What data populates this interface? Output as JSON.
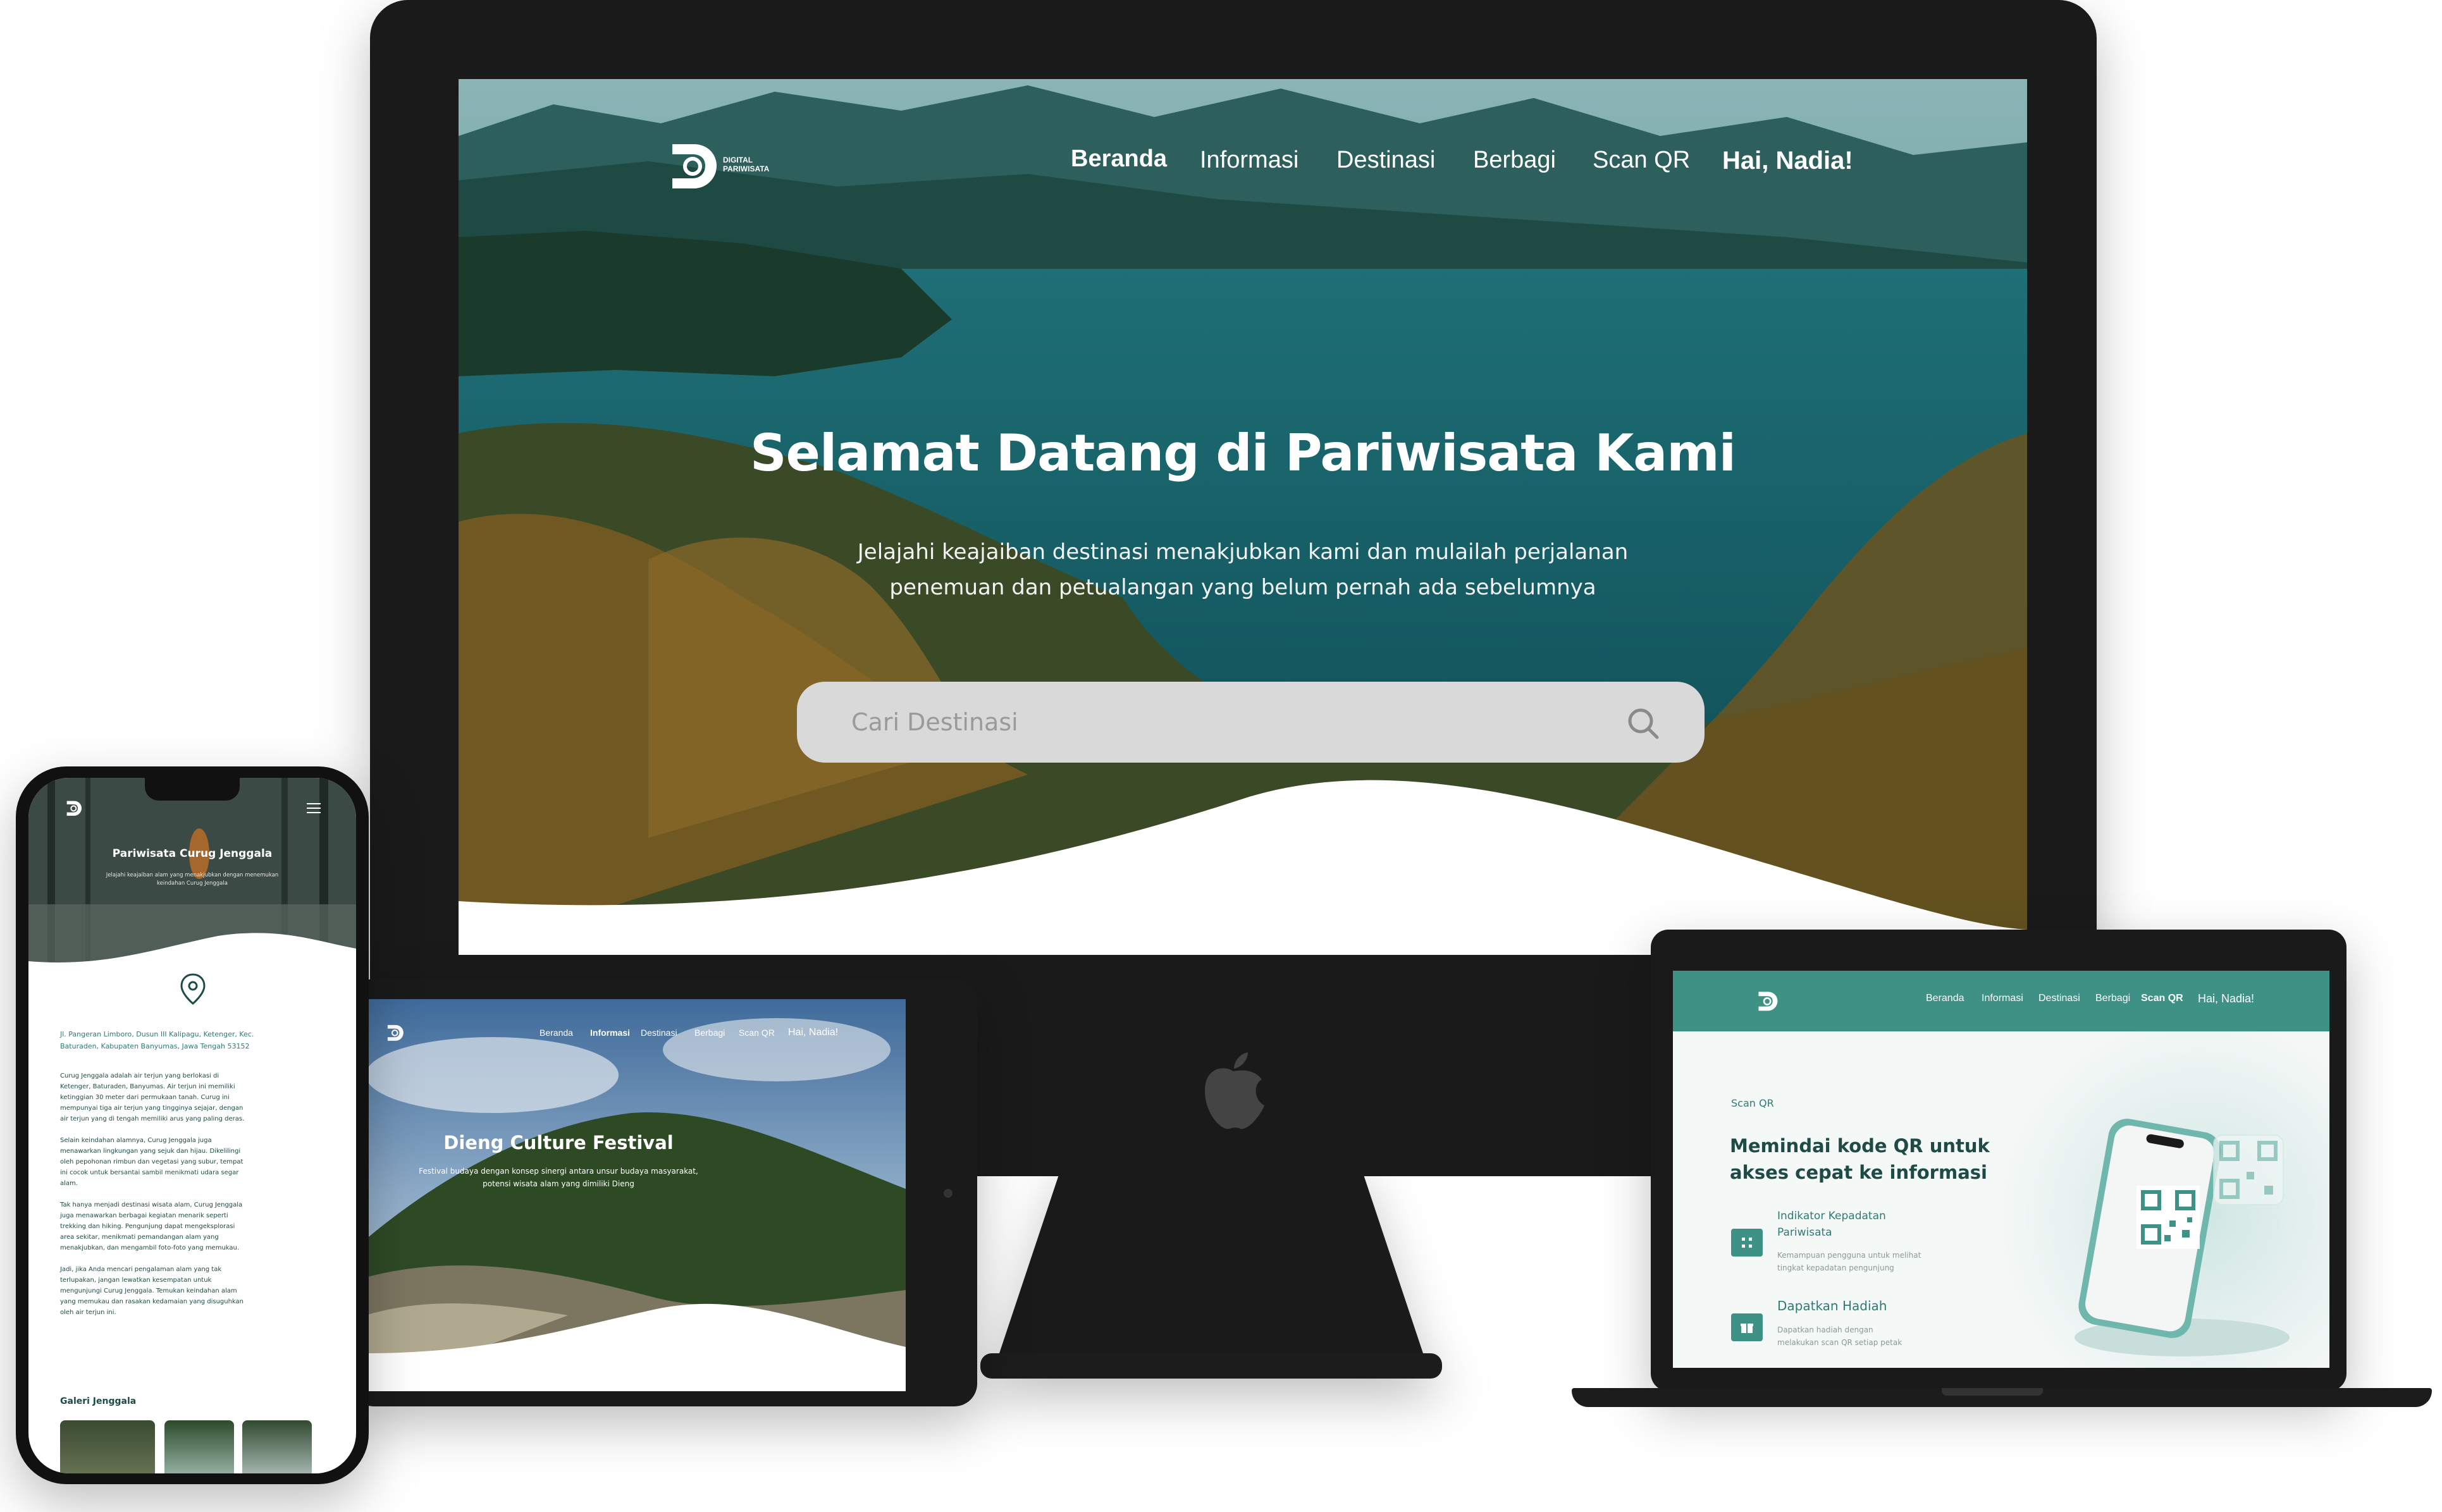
{
  "monitor": {
    "logo_line1": "DIGITAL",
    "logo_line2": "PARIWISATA",
    "nav": [
      "Beranda",
      "Informasi",
      "Destinasi",
      "Berbagi",
      "Scan QR",
      "Hai, Nadia!"
    ],
    "hero_title": "Selamat Datang di Pariwisata Kami",
    "hero_subtitle_line1": "Jelajahi keajaiban destinasi menakjubkan kami dan mulailah perjalanan",
    "hero_subtitle_line2": "penemuan dan petualangan yang belum pernah ada sebelumnya",
    "search_placeholder": "Cari Destinasi"
  },
  "tablet": {
    "nav": [
      "Beranda",
      "Informasi",
      "Destinasi",
      "Berbagi",
      "Scan QR",
      "Hai, Nadia!"
    ],
    "hero_title": "Dieng Culture Festival",
    "hero_subtitle_line1": "Festival budaya dengan konsep sinergi antara unsur budaya masyarakat,",
    "hero_subtitle_line2": "potensi wisata alam yang dimiliki Dieng"
  },
  "laptop": {
    "nav": [
      "Beranda",
      "Informasi",
      "Destinasi",
      "Berbagi",
      "Scan QR",
      "Hai, Nadia!"
    ],
    "section_label": "Scan QR",
    "heading_line1": "Memindai kode QR untuk",
    "heading_line2": "akses cepat ke informasi",
    "feature1_title_line1": "Indikator Kepadatan",
    "feature1_title_line2": "Pariwisata",
    "feature1_desc_line1": "Kemampuan pengguna untuk melihat",
    "feature1_desc_line2": "tingkat kepadatan pengunjung",
    "feature2_title": "Dapatkan Hadiah",
    "feature2_desc_line1": "Dapatkan hadiah dengan",
    "feature2_desc_line2": "melakukan scan QR setiap petak"
  },
  "phone": {
    "hero_title": "Pariwisata Curug Jenggala",
    "hero_subtitle_line1": "Jelajahi keajaiban alam yang menakjubkan dengan menemukan",
    "hero_subtitle_line2": "keindahan Curug Jenggala",
    "address_line1": "Jl. Pangeran Limboro, Dusun III Kalipagu, Ketenger, Kec.",
    "address_line2": "Baturaden, Kabupaten Banyumas, Jawa Tengah 53152",
    "p1": [
      "Curug Jenggala adalah air terjun yang berlokasi di",
      "Ketenger, Baturaden, Banyumas. Air terjun ini memiliki",
      "ketinggian 30 meter dari permukaan tanah. Curug ini",
      "mempunyai tiga air terjun yang tingginya sejajar, dengan",
      "air terjun yang di tengah memiliki arus yang paling deras."
    ],
    "p2": [
      "Selain keindahan alamnya, Curug Jenggala juga",
      "menawarkan lingkungan yang sejuk dan hijau. Dikelilingi",
      "oleh pepohonan rimbun dan vegetasi yang subur, tempat",
      "ini cocok untuk bersantai sambil menikmati udara segar",
      "alam."
    ],
    "p3": [
      "Tak hanya menjadi destinasi wisata alam, Curug Jenggala",
      "juga menawarkan berbagai kegiatan menarik seperti",
      "trekking dan hiking. Pengunjung dapat mengeksplorasi",
      "area sekitar, menikmati pemandangan alam yang",
      "menakjubkan, dan mengambil foto-foto yang memukau."
    ],
    "p4": [
      "Jadi, jika Anda mencari pengalaman alam yang tak",
      "terlupakan, jangan lewatkan kesempatan untuk",
      "mengunjungi Curug Jenggala. Temukan keindahan alam",
      "yang memukau dan rasakan kedamaian yang disuguhkan",
      "oleh air terjun ini."
    ],
    "gallery_title": "Galeri Jenggala"
  },
  "colors": {
    "accent": "#2c7c74",
    "device": "#1a1a1a",
    "search": "#d9d9d9"
  },
  "icons": [
    "logo-icon",
    "search-icon",
    "apple-logo-icon",
    "location-pin-icon",
    "menu-icon",
    "grid-icon",
    "gift-icon",
    "qr-code-icon"
  ]
}
